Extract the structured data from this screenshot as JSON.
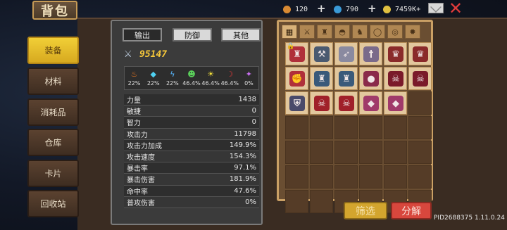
{
  "header": {
    "title": "背包",
    "resources": [
      {
        "name": "gold-resource",
        "value": "120",
        "color": "#d88a33"
      },
      {
        "name": "gem-resource",
        "value": "790",
        "color": "#3a9ad6"
      },
      {
        "name": "coin-resource",
        "value": "7459K+",
        "color": "#e0c040"
      }
    ]
  },
  "sidebar": {
    "items": [
      {
        "label": "装备",
        "active": true
      },
      {
        "label": "材料",
        "active": false
      },
      {
        "label": "消耗品",
        "active": false
      },
      {
        "label": "仓库",
        "active": false
      },
      {
        "label": "卡片",
        "active": false
      },
      {
        "label": "回收站",
        "active": false
      }
    ]
  },
  "stats": {
    "tabs": [
      "输出",
      "防御",
      "其他"
    ],
    "active_tab": "输出",
    "power": "95147",
    "elements": [
      {
        "icon": "fire-icon",
        "color": "#f07a20",
        "glyph": "♨",
        "pct": "22%"
      },
      {
        "icon": "ice-icon",
        "color": "#4fd0f0",
        "glyph": "◆",
        "pct": "22%"
      },
      {
        "icon": "lightning-icon",
        "color": "#58b8ff",
        "glyph": "ϟ",
        "pct": "22%"
      },
      {
        "icon": "poison-icon",
        "color": "#5cd65c",
        "glyph": "☻",
        "pct": "46.4%"
      },
      {
        "icon": "light-icon",
        "color": "#f3e03a",
        "glyph": "☀",
        "pct": "46.4%"
      },
      {
        "icon": "dark-icon",
        "color": "#d83a3a",
        "glyph": "☽",
        "pct": "46.4%"
      },
      {
        "icon": "arcane-icon",
        "color": "#c870f0",
        "glyph": "✦",
        "pct": "0%"
      }
    ],
    "rows": [
      {
        "label": "力量",
        "value": "1438"
      },
      {
        "label": "敏捷",
        "value": "0"
      },
      {
        "label": "智力",
        "value": "0"
      },
      {
        "label": "攻击力",
        "value": "11798"
      },
      {
        "label": "攻击力加成",
        "value": "149.9%"
      },
      {
        "label": "攻击速度",
        "value": "154.3%"
      },
      {
        "label": "暴击率",
        "value": "97.1%"
      },
      {
        "label": "暴击伤害",
        "value": "181.9%"
      },
      {
        "label": "命中率",
        "value": "47.6%"
      },
      {
        "label": "普攻伤害",
        "value": "0%"
      }
    ]
  },
  "inventory": {
    "filters": [
      {
        "icon": "grid-all-icon",
        "glyph": "▦"
      },
      {
        "icon": "weapon-filter-icon",
        "glyph": "⚔"
      },
      {
        "icon": "armor-filter-icon",
        "glyph": "♜"
      },
      {
        "icon": "helmet-filter-icon",
        "glyph": "◓"
      },
      {
        "icon": "boots-filter-icon",
        "glyph": "♞"
      },
      {
        "icon": "necklace-filter-icon",
        "glyph": "◯"
      },
      {
        "icon": "ring-filter-icon",
        "glyph": "◎"
      },
      {
        "icon": "gear-filter-icon",
        "glyph": "✹"
      }
    ],
    "items": [
      {
        "icon": "chest-armor-icon",
        "glyph": "♜",
        "color": "#b0303a",
        "locked": true
      },
      {
        "icon": "axe-icon",
        "glyph": "⚒",
        "color": "#4a5a70",
        "locked": false
      },
      {
        "icon": "spear-icon",
        "glyph": "➶",
        "color": "#8a8aa0",
        "locked": false
      },
      {
        "icon": "sword-icon",
        "glyph": "†",
        "color": "#7a6a8a",
        "locked": false
      },
      {
        "icon": "crown-helmet-icon",
        "glyph": "♛",
        "color": "#8a2a2a",
        "locked": false
      },
      {
        "icon": "crown-helmet-icon",
        "glyph": "♛",
        "color": "#8a2a2a",
        "locked": false
      },
      {
        "icon": "gauntlet-icon",
        "glyph": "✊",
        "color": "#b0303a",
        "locked": false
      },
      {
        "icon": "armor-icon",
        "glyph": "♜",
        "color": "#3a5a7a",
        "locked": false
      },
      {
        "icon": "armor-icon",
        "glyph": "♜",
        "color": "#3a5a7a",
        "locked": false
      },
      {
        "icon": "orb-icon",
        "glyph": "●",
        "color": "#8a2a4a",
        "locked": false
      },
      {
        "icon": "demon-helmet-icon",
        "glyph": "☠",
        "color": "#7a1a2a",
        "locked": false
      },
      {
        "icon": "demon-helmet-icon",
        "glyph": "☠",
        "color": "#7a1a2a",
        "locked": false
      },
      {
        "icon": "shield-icon",
        "glyph": "⛨",
        "color": "#4a4a6a",
        "locked": false
      },
      {
        "icon": "beast-mask-icon",
        "glyph": "☠",
        "color": "#a0202a",
        "locked": false
      },
      {
        "icon": "beast-mask-icon",
        "glyph": "☠",
        "color": "#a0202a",
        "locked": false
      },
      {
        "icon": "gem-ring-icon",
        "glyph": "◆",
        "color": "#a03a6a",
        "locked": false
      },
      {
        "icon": "gem-ring-icon",
        "glyph": "◆",
        "color": "#a03a6a",
        "locked": false
      }
    ],
    "total_slots": 42
  },
  "buttons": {
    "filter": "筛选",
    "decompose": "分解"
  },
  "footer": {
    "pid": "PID2688375 1.11.0.24"
  }
}
